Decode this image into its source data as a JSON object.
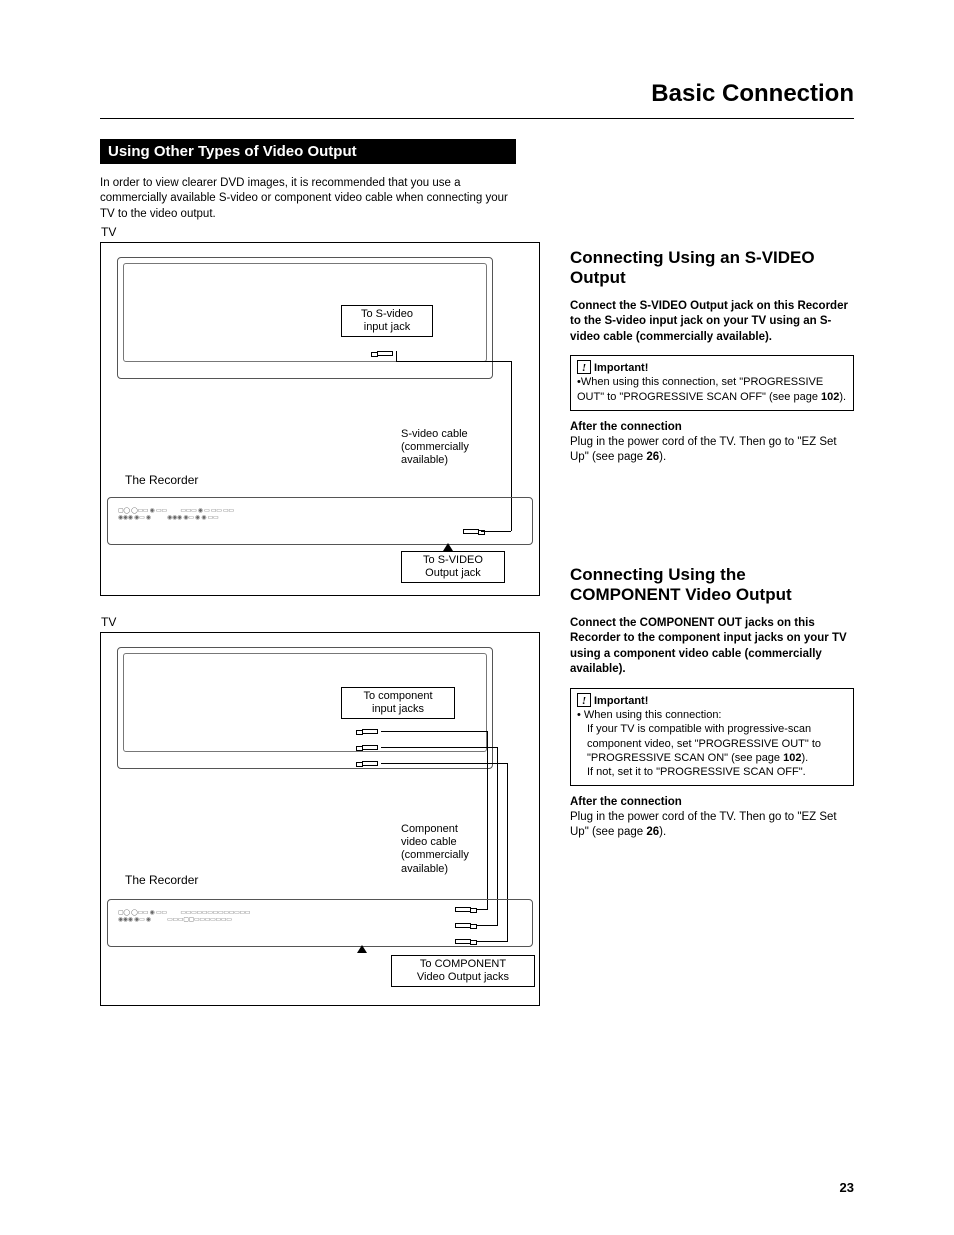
{
  "page_title": "Basic Connection",
  "section_bar": "Using Other Types of Video Output",
  "intro": "In order to view clearer DVD images, it is recommended that you use a commercially available S-video or component video cable when connecting your TV to the video output.",
  "diagram1": {
    "tv_label": "TV",
    "to_input": "To S-video\ninput jack",
    "recorder_label": "The Recorder",
    "cable_note": "S-video cable\n(commercially\navailable)",
    "to_output": "To S-VIDEO\nOutput jack"
  },
  "diagram2": {
    "tv_label": "TV",
    "to_input": "To component\ninput jacks",
    "recorder_label": "The Recorder",
    "cable_note": "Component\nvideo cable\n(commercially\navailable)",
    "to_output": "To COMPONENT\nVideo Output jacks"
  },
  "right1": {
    "heading": "Connecting Using an S-VIDEO Output",
    "bold": "Connect the S-VIDEO Output jack on this Recorder to the S-video input jack on your TV using an S-video cable (commercially available).",
    "important_label": "Important!",
    "important_body_pre": "•When using this connection, set \"PROGRESSIVE OUT\" to \"PROGRESSIVE SCAN OFF\" (see page ",
    "important_page": "102",
    "important_body_post": ").",
    "after_h": "After the connection",
    "after_pre": "Plug in the power cord of the TV. Then go to \"EZ Set Up\" (see page ",
    "after_page": "26",
    "after_post": ")."
  },
  "right2": {
    "heading": "Connecting Using the COMPONENT Video Output",
    "bold": "Connect the COMPONENT OUT jacks on this Recorder to the component input jacks on your TV using a component video cable (commercially available).",
    "important_label": "Important!",
    "important_line1": "• When using this connection:",
    "important_body_pre": "If your TV is compatible with progressive-scan component video, set \"PROGRESSIVE OUT\" to \"PROGRESSIVE SCAN ON\" (see page ",
    "important_page": "102",
    "important_body_post": ").",
    "important_tail": "If not, set it to \"PROGRESSIVE SCAN OFF\".",
    "after_h": "After the connection",
    "after_pre": "Plug in the power cord of the TV. Then go to \"EZ Set Up\" (see page ",
    "after_page": "26",
    "after_post": ")."
  },
  "page_number": "23"
}
